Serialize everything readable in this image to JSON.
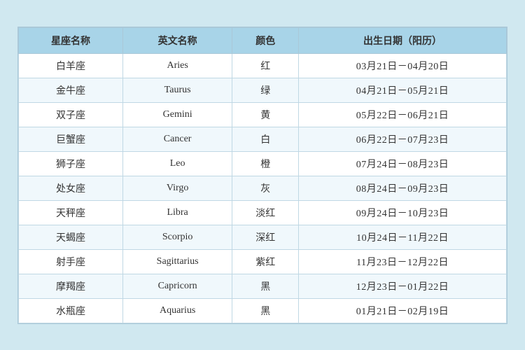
{
  "table": {
    "headers": [
      "星座名称",
      "英文名称",
      "颜色",
      "出生日期（阳历）"
    ],
    "rows": [
      {
        "chinese": "白羊座",
        "english": "Aries",
        "color": "红",
        "dates": "03月21日－04月20日"
      },
      {
        "chinese": "金牛座",
        "english": "Taurus",
        "color": "绿",
        "dates": "04月21日－05月21日"
      },
      {
        "chinese": "双子座",
        "english": "Gemini",
        "color": "黄",
        "dates": "05月22日－06月21日"
      },
      {
        "chinese": "巨蟹座",
        "english": "Cancer",
        "color": "白",
        "dates": "06月22日－07月23日"
      },
      {
        "chinese": "狮子座",
        "english": "Leo",
        "color": "橙",
        "dates": "07月24日－08月23日"
      },
      {
        "chinese": "处女座",
        "english": "Virgo",
        "color": "灰",
        "dates": "08月24日－09月23日"
      },
      {
        "chinese": "天秤座",
        "english": "Libra",
        "color": "淡红",
        "dates": "09月24日－10月23日"
      },
      {
        "chinese": "天蝎座",
        "english": "Scorpio",
        "color": "深红",
        "dates": "10月24日－11月22日"
      },
      {
        "chinese": "射手座",
        "english": "Sagittarius",
        "color": "紫红",
        "dates": "11月23日－12月22日"
      },
      {
        "chinese": "摩羯座",
        "english": "Capricorn",
        "color": "黑",
        "dates": "12月23日－01月22日"
      },
      {
        "chinese": "水瓶座",
        "english": "Aquarius",
        "color": "黑",
        "dates": "01月21日－02月19日"
      }
    ]
  }
}
